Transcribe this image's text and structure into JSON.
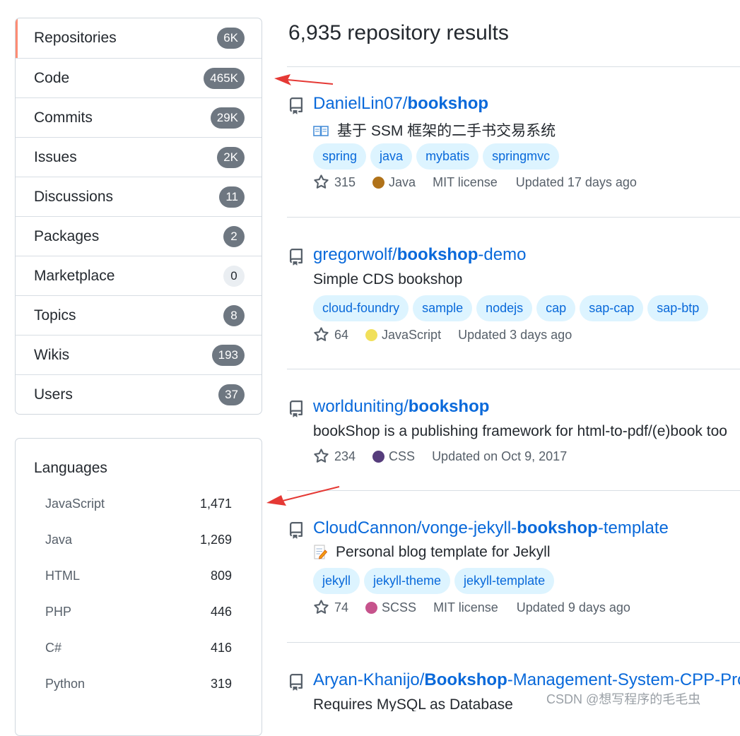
{
  "nav": [
    {
      "label": "Repositories",
      "count": "6K"
    },
    {
      "label": "Code",
      "count": "465K"
    },
    {
      "label": "Commits",
      "count": "29K"
    },
    {
      "label": "Issues",
      "count": "2K"
    },
    {
      "label": "Discussions",
      "count": "11"
    },
    {
      "label": "Packages",
      "count": "2"
    },
    {
      "label": "Marketplace",
      "count": "0"
    },
    {
      "label": "Topics",
      "count": "8"
    },
    {
      "label": "Wikis",
      "count": "193"
    },
    {
      "label": "Users",
      "count": "37"
    }
  ],
  "languages": {
    "title": "Languages",
    "items": [
      {
        "name": "JavaScript",
        "count": "1,471"
      },
      {
        "name": "Java",
        "count": "1,269"
      },
      {
        "name": "HTML",
        "count": "809"
      },
      {
        "name": "PHP",
        "count": "446"
      },
      {
        "name": "C#",
        "count": "416"
      },
      {
        "name": "Python",
        "count": "319"
      }
    ]
  },
  "results_title": "6,935 repository results",
  "repos": [
    {
      "owner": "DanielLin07/",
      "name_bold": "bookshop",
      "name_rest": "",
      "description": "基于 SSM 框架的二手书交易系统",
      "topics": [
        "spring",
        "java",
        "mybatis",
        "springmvc"
      ],
      "stars": "315",
      "language": "Java",
      "language_color": "#b07219",
      "license": "MIT license",
      "updated": "Updated 17 days ago"
    },
    {
      "owner": "gregorwolf/",
      "name_bold": "bookshop",
      "name_rest": "-demo",
      "description": "Simple CDS bookshop",
      "topics": [
        "cloud-foundry",
        "sample",
        "nodejs",
        "cap",
        "sap-cap",
        "sap-btp"
      ],
      "stars": "64",
      "language": "JavaScript",
      "language_color": "#f1e05a",
      "license": "",
      "updated": "Updated 3 days ago"
    },
    {
      "owner": "worlduniting/",
      "name_bold": "bookshop",
      "name_rest": "",
      "description": "bookShop is a publishing framework for html-to-pdf/(e)book too",
      "topics": [],
      "stars": "234",
      "language": "CSS",
      "language_color": "#563d7c",
      "license": "",
      "updated": "Updated on Oct 9, 2017"
    },
    {
      "owner": "CloudCannon/vonge-jekyll-",
      "name_bold": "bookshop",
      "name_rest": "-template",
      "description": "Personal blog template for Jekyll",
      "topics": [
        "jekyll",
        "jekyll-theme",
        "jekyll-template"
      ],
      "stars": "74",
      "language": "SCSS",
      "language_color": "#c6538c",
      "license": "MIT license",
      "updated": "Updated 9 days ago"
    },
    {
      "owner": "Aryan-Khanijo/",
      "name_bold": "Bookshop",
      "name_rest": "-Management-System-CPP-Pro",
      "description": "Requires MySQL as Database",
      "topics": [],
      "stars": "",
      "language": "",
      "language_color": "",
      "license": "",
      "updated": ""
    }
  ],
  "watermark": "CSDN @想写程序的毛毛虫",
  "colors": {
    "accent": "#0969da",
    "selected_bar": "#fd8c73",
    "annotation_arrow": "#e53935",
    "topic_bg": "#ddf4ff"
  }
}
